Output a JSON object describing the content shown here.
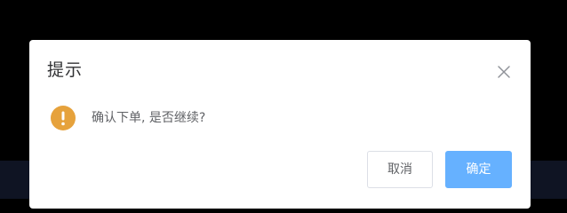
{
  "dialog": {
    "title": "提示",
    "message": "确认下单, 是否继续?",
    "close_icon": "close-icon",
    "warning_icon": "warning-icon",
    "cancel_label": "取消",
    "confirm_label": "确定"
  },
  "colors": {
    "backdrop": "#000000",
    "backdrop_strip": "#0f1423",
    "warning": "#e6a23c",
    "primary": "#66b1ff",
    "text_primary": "#303133",
    "text_regular": "#606266",
    "border": "#dcdfe6"
  }
}
